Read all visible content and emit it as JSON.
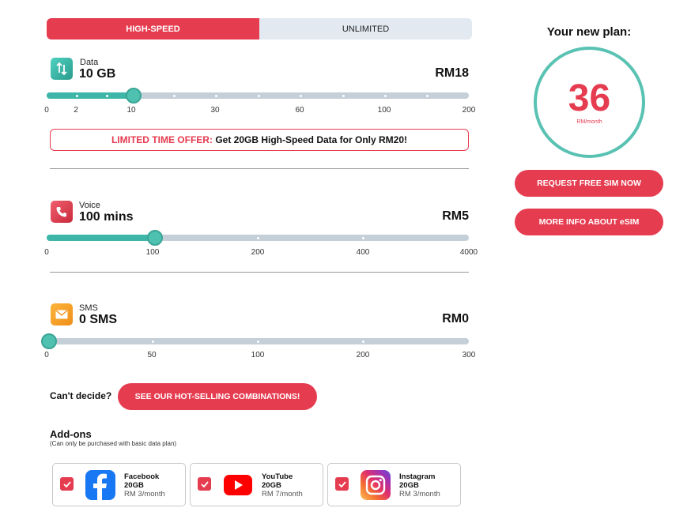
{
  "tabs": {
    "active": "HIGH-SPEED",
    "inactive": "UNLIMITED"
  },
  "data_section": {
    "label": "Data",
    "value": "10 GB",
    "price": "RM18",
    "ticks": [
      "0",
      "2",
      "10",
      "30",
      "60",
      "100",
      "200"
    ],
    "level": 0.2
  },
  "offer": {
    "highlight": "LIMITED TIME OFFER:",
    "text": "Get 20GB High-Speed Data for Only RM20!"
  },
  "voice_section": {
    "label": "Voice",
    "value": "100 mins",
    "price": "RM5",
    "ticks": [
      "0",
      "100",
      "200",
      "400",
      "4000"
    ],
    "level": 0.25
  },
  "sms_section": {
    "label": "SMS",
    "value": "0 SMS",
    "price": "RM0",
    "ticks": [
      "0",
      "50",
      "100",
      "200",
      "300"
    ],
    "level": 0
  },
  "plan": {
    "title": "Your new plan:",
    "amount": "36",
    "unit": "RM/month"
  },
  "buttons": {
    "free_sim": "REQUEST FREE SIM NOW",
    "esim": "MORE INFO ABOUT eSIM",
    "combo": "SEE OUR HOT-SELLING COMBINATIONS!"
  },
  "cant_decide": "Can't decide?",
  "addons": {
    "title": "Add-ons",
    "note": "(Can only be purchased with basic data plan)",
    "items": [
      {
        "name": "Facebook",
        "size": "20GB",
        "price": "RM 3/month",
        "icon": "facebook-icon"
      },
      {
        "name": "YouTube",
        "size": "20GB",
        "price": "RM 7/month",
        "icon": "youtube-icon"
      },
      {
        "name": "Instagram",
        "size": "20GB",
        "price": "RM 3/month",
        "icon": "instagram-icon"
      }
    ]
  },
  "colors": {
    "accent": "#e63c50",
    "teal": "#3db6a8",
    "track": "#c4cfd8",
    "tab_inactive": "#e2e9f1"
  }
}
